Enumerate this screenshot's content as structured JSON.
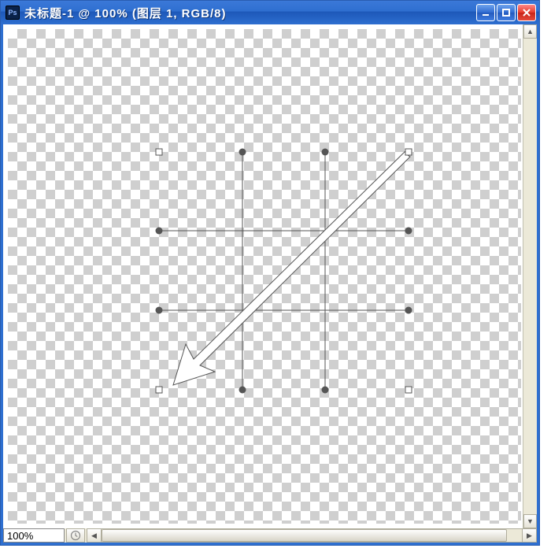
{
  "title": "未标题-1 @ 100% (图层 1, RGB/8)",
  "app_icon_text": "Ps",
  "zoom": "100%",
  "icons": {
    "minimize": "minimize-icon",
    "maximize": "maximize-icon",
    "close": "close-icon",
    "history": "history-icon",
    "scroll_up": "▲",
    "scroll_down": "▼",
    "scroll_left": "◀",
    "scroll_right": "▶"
  },
  "transform": {
    "cols": 3,
    "rows": 3,
    "arrow_from": "top-right",
    "arrow_to": "bottom-left"
  }
}
